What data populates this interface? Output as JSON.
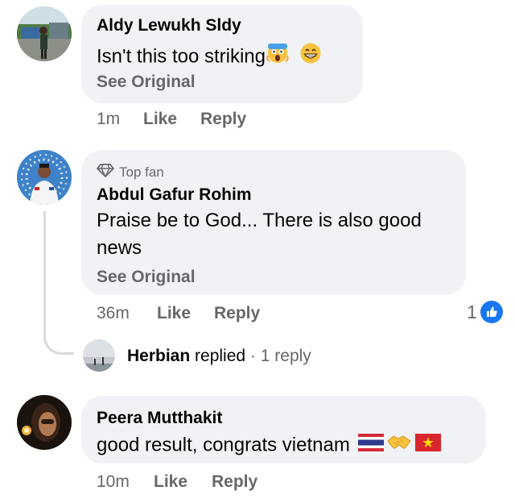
{
  "comments": [
    {
      "author": "Aldy Lewukh Sldy",
      "text": "Isn't this too striking",
      "see_original": "See Original",
      "time": "1m",
      "like_label": "Like",
      "reply_label": "Reply"
    },
    {
      "badge": "Top fan",
      "author": "Abdul Gafur Rohim",
      "text": "Praise be to God... There is also good news",
      "see_original": "See Original",
      "time": "36m",
      "like_label": "Like",
      "reply_label": "Reply",
      "reaction_count": "1",
      "replies": {
        "author": "Herbian",
        "verb": "replied",
        "separator": "·",
        "count": "1 reply"
      }
    },
    {
      "author": "Peera Mutthakit",
      "text": "good result, congrats vietnam",
      "time": "10m",
      "like_label": "Like",
      "reply_label": "Reply"
    }
  ],
  "colors": {
    "bubble": "#f0f2f5",
    "secondary_text": "#65676b",
    "like_blue": "#1877f2"
  },
  "icons": [
    "scream-emoji",
    "grin-emoji",
    "diamond-icon",
    "thumbs-up-icon",
    "thailand-flag",
    "handshake-emoji",
    "vietnam-flag"
  ]
}
